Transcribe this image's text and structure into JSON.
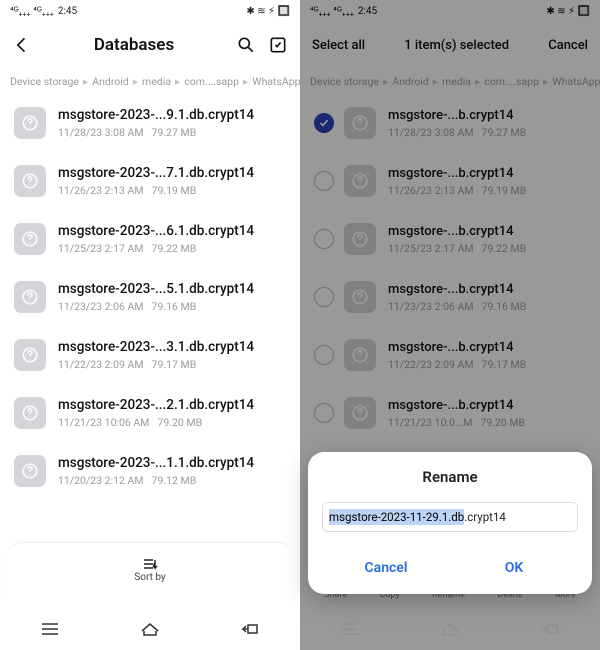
{
  "status": {
    "time": "2:45",
    "net": "⁴ᴳ₊₊₊  ⁴ᴳ₊₊₊",
    "icons": "⋮≋ ⊕ ⬚"
  },
  "left": {
    "title": "Databases",
    "crumbs": [
      "Device storage",
      "Android",
      "media",
      "com....sapp",
      "WhatsApp"
    ],
    "files": [
      {
        "name": "msgstore-2023-...9.1.db.crypt14",
        "date": "11/28/23 3:08 AM",
        "size": "79.27 MB"
      },
      {
        "name": "msgstore-2023-...7.1.db.crypt14",
        "date": "11/26/23 2:13 AM",
        "size": "79.19 MB"
      },
      {
        "name": "msgstore-2023-...6.1.db.crypt14",
        "date": "11/25/23 2:17 AM",
        "size": "79.22 MB"
      },
      {
        "name": "msgstore-2023-...5.1.db.crypt14",
        "date": "11/23/23 2:06 AM",
        "size": "79.16 MB"
      },
      {
        "name": "msgstore-2023-...3.1.db.crypt14",
        "date": "11/22/23 2:09 AM",
        "size": "79.17 MB"
      },
      {
        "name": "msgstore-2023-...2.1.db.crypt14",
        "date": "11/21/23 10:06 AM",
        "size": "79.20 MB"
      },
      {
        "name": "msgstore-2023-...1.1.db.crypt14",
        "date": "11/20/23 2:12 AM",
        "size": "79.12 MB"
      }
    ],
    "sortBy": "Sort by"
  },
  "right": {
    "selectAll": "Select all",
    "selected": "1 item(s) selected",
    "cancel": "Cancel",
    "crumbs": [
      "Device storage",
      "Android",
      "media",
      "com....sapp",
      "WhatsApp"
    ],
    "files": [
      {
        "name": "msgstore-...b.crypt14",
        "date": "11/28/23 3:08 AM",
        "size": "79.27 MB",
        "checked": true
      },
      {
        "name": "msgstore-...b.crypt14",
        "date": "11/26/23 2:13 AM",
        "size": "79.19 MB",
        "checked": false
      },
      {
        "name": "msgstore-...b.crypt14",
        "date": "11/25/23 2:17 AM",
        "size": "79.22 MB",
        "checked": false
      },
      {
        "name": "msgstore-...b.crypt14",
        "date": "11/23/23 2:06 AM",
        "size": "79.16 MB",
        "checked": false
      },
      {
        "name": "msgstore-...b.crypt14",
        "date": "11/22/23 2:09 AM",
        "size": "79.17 MB",
        "checked": false
      },
      {
        "name": "msgstore-...b.crypt14",
        "date": "11/21/23 10:0...M",
        "size": "79.20 MB",
        "checked": false
      }
    ],
    "actions": [
      "Share",
      "Copy",
      "Rename",
      "Delete",
      "More"
    ],
    "dialog": {
      "title": "Rename",
      "selected": "msgstore-2023-11-29.1.db",
      "rest": ".crypt14",
      "cancel": "Cancel",
      "ok": "OK"
    }
  }
}
